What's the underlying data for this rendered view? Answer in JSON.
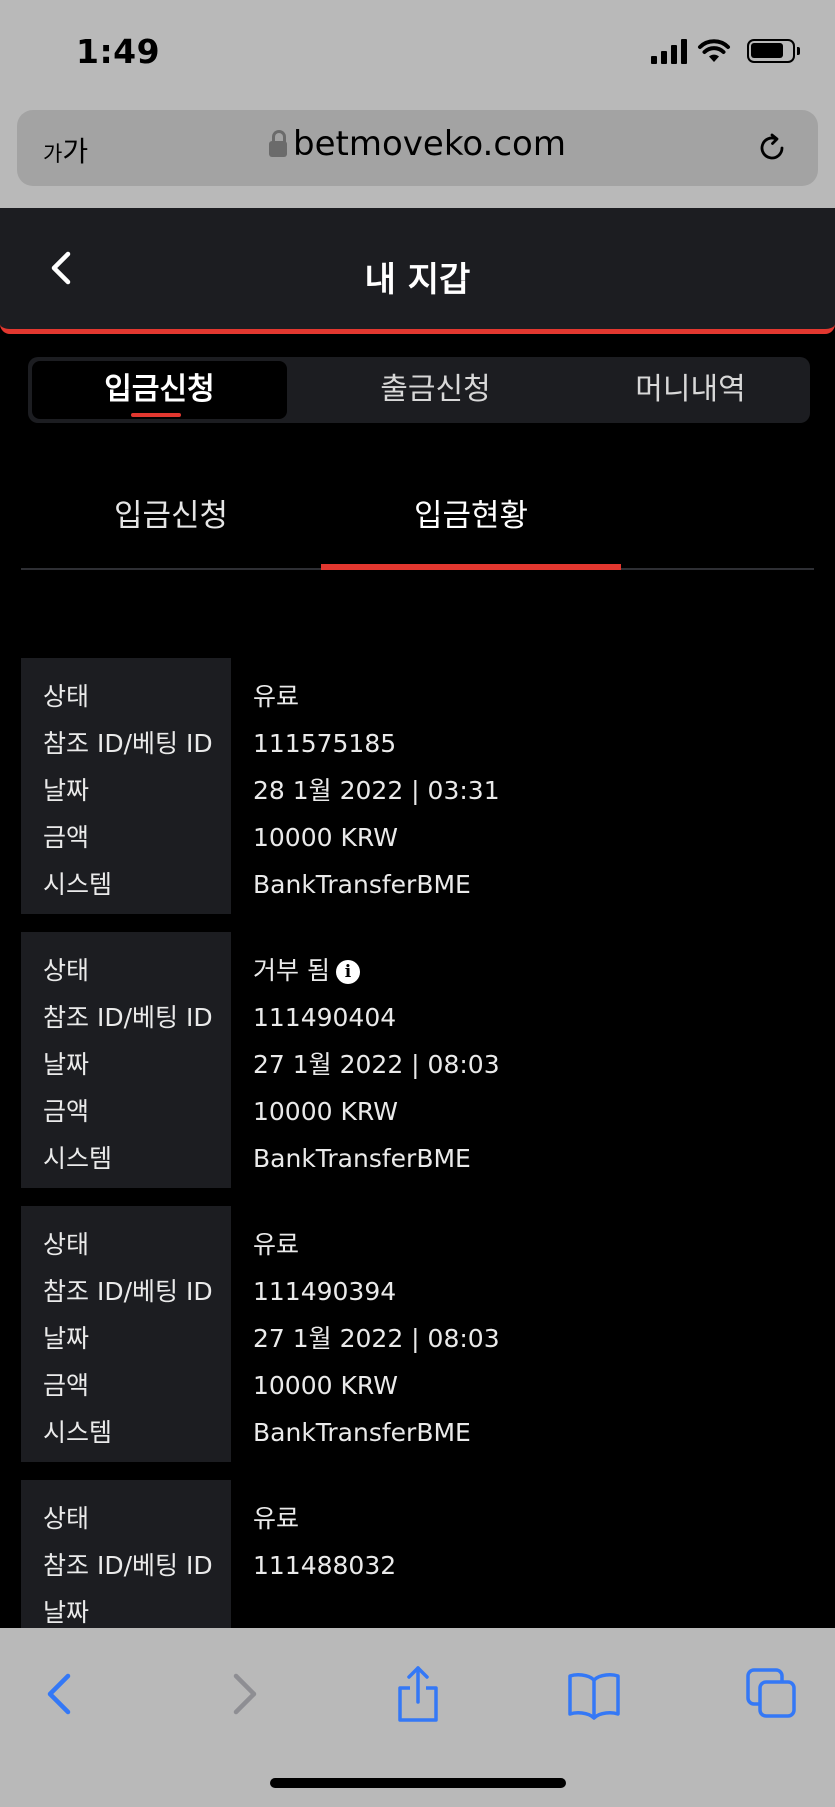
{
  "status_bar": {
    "time": "1:49",
    "icons": [
      "cellular-signal-icon",
      "wifi-icon",
      "battery-icon"
    ]
  },
  "browser": {
    "text_size_label_small": "가",
    "text_size_label_large": "가",
    "url": "betmoveko.com",
    "icons": [
      "lock-icon",
      "reload-icon"
    ]
  },
  "header": {
    "title": "내 지갑",
    "back_icon": "chevron-left-icon"
  },
  "wallet_tabs": [
    {
      "label": "입금신청",
      "active": true
    },
    {
      "label": "출금신청",
      "active": false
    },
    {
      "label": "머니내역",
      "active": false
    }
  ],
  "sub_tabs": [
    {
      "label": "입금신청",
      "active": false
    },
    {
      "label": "입금현황",
      "active": true
    }
  ],
  "field_labels": {
    "status": "상태",
    "ref_id": "참조 ID/베팅 ID",
    "date": "날짜",
    "amount": "금액",
    "system": "시스템"
  },
  "records": [
    {
      "status": "유료",
      "ref_id": "111575185",
      "date": "28 1월 2022 | 03:31",
      "amount": "10000 KRW",
      "system": "BankTransferBME",
      "has_info": false
    },
    {
      "status": "거부 됨",
      "ref_id": "111490404",
      "date": "27 1월 2022 | 08:03",
      "amount": "10000 KRW",
      "system": "BankTransferBME",
      "has_info": true
    },
    {
      "status": "유료",
      "ref_id": "111490394",
      "date": "27 1월 2022 | 08:03",
      "amount": "10000 KRW",
      "system": "BankTransferBME",
      "has_info": false
    },
    {
      "status": "유료",
      "ref_id": "111488032",
      "date": "",
      "amount": "",
      "system": "",
      "has_info": false
    }
  ],
  "toolbar": {
    "icons": [
      "back-icon",
      "forward-icon",
      "share-icon",
      "bookmarks-icon",
      "tabs-icon"
    ],
    "accent": "#3478f6",
    "disabled": "#8e8e93"
  },
  "colors": {
    "accent_red": "#e2372f",
    "panel": "#1c1d21",
    "background": "#000000"
  }
}
